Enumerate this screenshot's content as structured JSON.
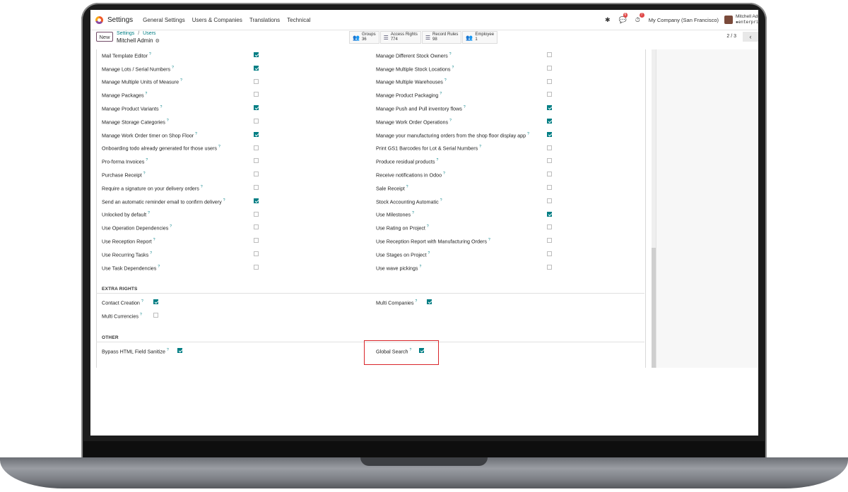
{
  "topbar": {
    "app_name": "Settings",
    "menu": [
      "General Settings",
      "Users & Companies",
      "Translations",
      "Technical"
    ],
    "chat_badge": "6",
    "activity_badge": "7",
    "company": "My Company (San Francisco)",
    "user_name": "Mitchell Admi",
    "user_db": "enterpris"
  },
  "controlbar": {
    "new_label": "New",
    "breadcrumb_parent": "Settings",
    "breadcrumb_separator": "/",
    "breadcrumb_section": "Users",
    "current_record": "Mitchell Admin",
    "pager": "2 / 3"
  },
  "smart_buttons": [
    {
      "label": "Groups",
      "count": "36"
    },
    {
      "label": "Access Rights",
      "count": "774"
    },
    {
      "label": "Record Rules",
      "count": "98"
    },
    {
      "label": "Employee",
      "count": "1"
    }
  ],
  "technical_rights": {
    "left": [
      {
        "label": "Mail Template Editor",
        "checked": true
      },
      {
        "label": "Manage Lots / Serial Numbers",
        "checked": true
      },
      {
        "label": "Manage Multiple Units of Measure",
        "checked": false
      },
      {
        "label": "Manage Packages",
        "checked": false
      },
      {
        "label": "Manage Product Variants",
        "checked": true
      },
      {
        "label": "Manage Storage Categories",
        "checked": false
      },
      {
        "label": "Manage Work Order timer on Shop Floor",
        "checked": true
      },
      {
        "label": "Onboarding todo already generated for those users",
        "checked": false
      },
      {
        "label": "Pro-forma Invoices",
        "checked": false
      },
      {
        "label": "Purchase Receipt",
        "checked": false
      },
      {
        "label": "Require a signature on your delivery orders",
        "checked": false
      },
      {
        "label": "Send an automatic reminder email to confirm delivery",
        "checked": true
      },
      {
        "label": "Unlocked by default",
        "checked": false
      },
      {
        "label": "Use Operation Dependencies",
        "checked": false
      },
      {
        "label": "Use Reception Report",
        "checked": false
      },
      {
        "label": "Use Recurring Tasks",
        "checked": false
      },
      {
        "label": "Use Task Dependencies",
        "checked": false
      }
    ],
    "right": [
      {
        "label": "Manage Different Stock Owners",
        "checked": false
      },
      {
        "label": "Manage Multiple Stock Locations",
        "checked": false
      },
      {
        "label": "Manage Multiple Warehouses",
        "checked": false
      },
      {
        "label": "Manage Product Packaging",
        "checked": false
      },
      {
        "label": "Manage Push and Pull inventory flows",
        "checked": true
      },
      {
        "label": "Manage Work Order Operations",
        "checked": true
      },
      {
        "label": "Manage your manufacturing orders from the shop floor display app",
        "checked": true
      },
      {
        "label": "Print GS1 Barcodes for Lot & Serial Numbers",
        "checked": false
      },
      {
        "label": "Produce residual products",
        "checked": false
      },
      {
        "label": "Receive notifications in Odoo",
        "checked": false
      },
      {
        "label": "Sale Receipt",
        "checked": false
      },
      {
        "label": "Stock Accounting Automatic",
        "checked": false
      },
      {
        "label": "Use Milestones",
        "checked": true
      },
      {
        "label": "Use Rating on Project",
        "checked": false
      },
      {
        "label": "Use Reception Report with Manufacturing Orders",
        "checked": false
      },
      {
        "label": "Use Stages on Project",
        "checked": false
      },
      {
        "label": "Use wave pickings",
        "checked": false
      }
    ]
  },
  "extra_rights": {
    "title": "EXTRA RIGHTS",
    "left": [
      {
        "label": "Contact Creation",
        "checked": true
      },
      {
        "label": "Multi Currencies",
        "checked": false
      }
    ],
    "right": [
      {
        "label": "Multi Companies",
        "checked": true
      }
    ]
  },
  "other": {
    "title": "OTHER",
    "left": [
      {
        "label": "Bypass HTML Field Sanitize",
        "checked": true
      }
    ],
    "right": [
      {
        "label": "Global Search",
        "checked": true
      }
    ]
  },
  "help_marker": "?",
  "colors": {
    "accent": "#017e84",
    "brand": "#714b67",
    "highlight": "#d9252a"
  }
}
